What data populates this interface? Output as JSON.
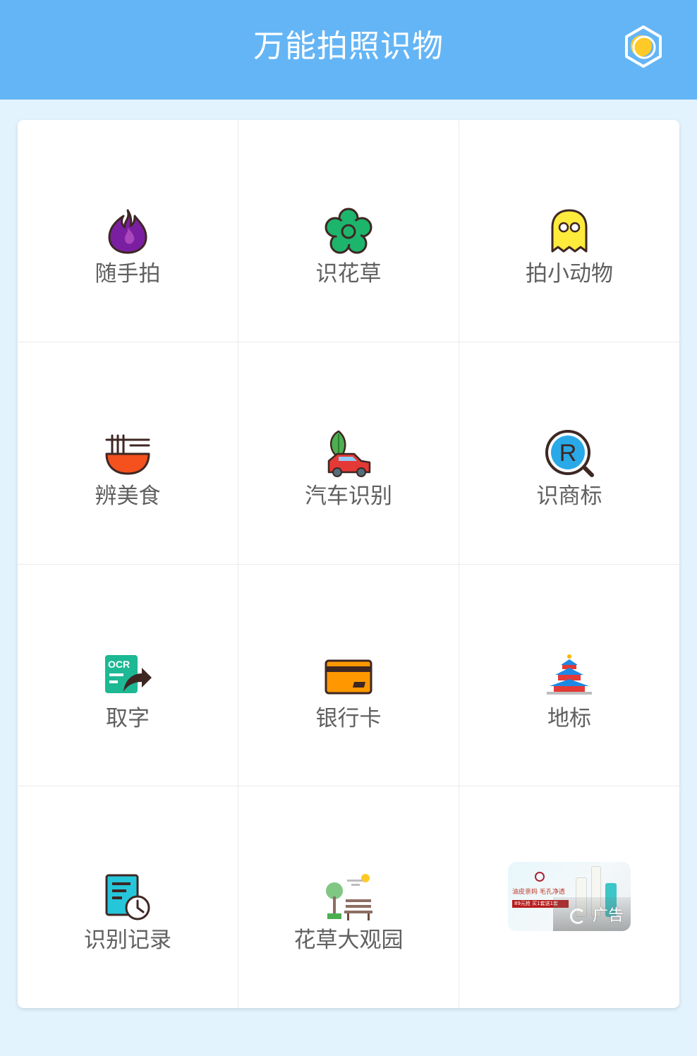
{
  "header": {
    "title": "万能拍照识物",
    "background_color": "#64B5F6",
    "action_icon": "hexagon-coin-icon"
  },
  "grid": {
    "items": [
      {
        "label": "随手拍",
        "icon": "fire-icon"
      },
      {
        "label": "识花草",
        "icon": "flower-icon"
      },
      {
        "label": "拍小动物",
        "icon": "ghost-animal-icon"
      },
      {
        "label": "辨美食",
        "icon": "noodle-bowl-icon"
      },
      {
        "label": "汽车识别",
        "icon": "car-icon"
      },
      {
        "label": "识商标",
        "icon": "trademark-search-icon"
      },
      {
        "label": "取字",
        "icon": "ocr-share-icon"
      },
      {
        "label": "银行卡",
        "icon": "bank-card-icon"
      },
      {
        "label": "地标",
        "icon": "temple-landmark-icon"
      },
      {
        "label": "识别记录",
        "icon": "history-record-icon"
      },
      {
        "label": "花草大观园",
        "icon": "park-bench-icon"
      }
    ]
  },
  "ad": {
    "headline": "油皮亲妈 毛孔净透",
    "promo": "89元抢 买1套送1套",
    "badge": "广告"
  },
  "colors": {
    "page_background": "#E3F3FD",
    "label_text": "#606060"
  }
}
